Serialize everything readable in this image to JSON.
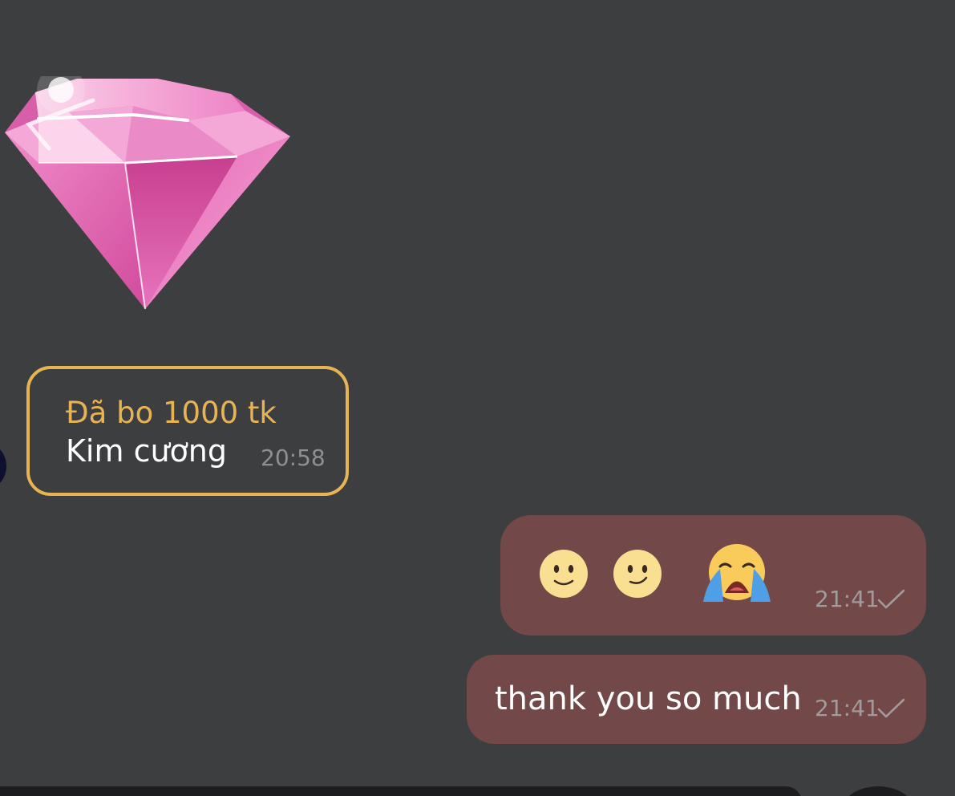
{
  "gift": {
    "title": "Đã bo 1000 tk",
    "name": "Kim cương",
    "time": "20:58",
    "sticker_icon": "pink-diamond-icon"
  },
  "emoji_message": {
    "emojis": [
      "slightly-smiling-face-icon",
      "slightly-smiling-face-icon",
      "loudly-crying-face-icon"
    ],
    "time": "21:41",
    "status": "sent"
  },
  "text_message": {
    "text": "thank you so much",
    "time": "21:41",
    "status": "sent"
  },
  "colors": {
    "background": "#3d3e40",
    "gift_border": "#e8b453",
    "outgoing_bubble": "#724848",
    "time_text": "#a29b9b"
  }
}
